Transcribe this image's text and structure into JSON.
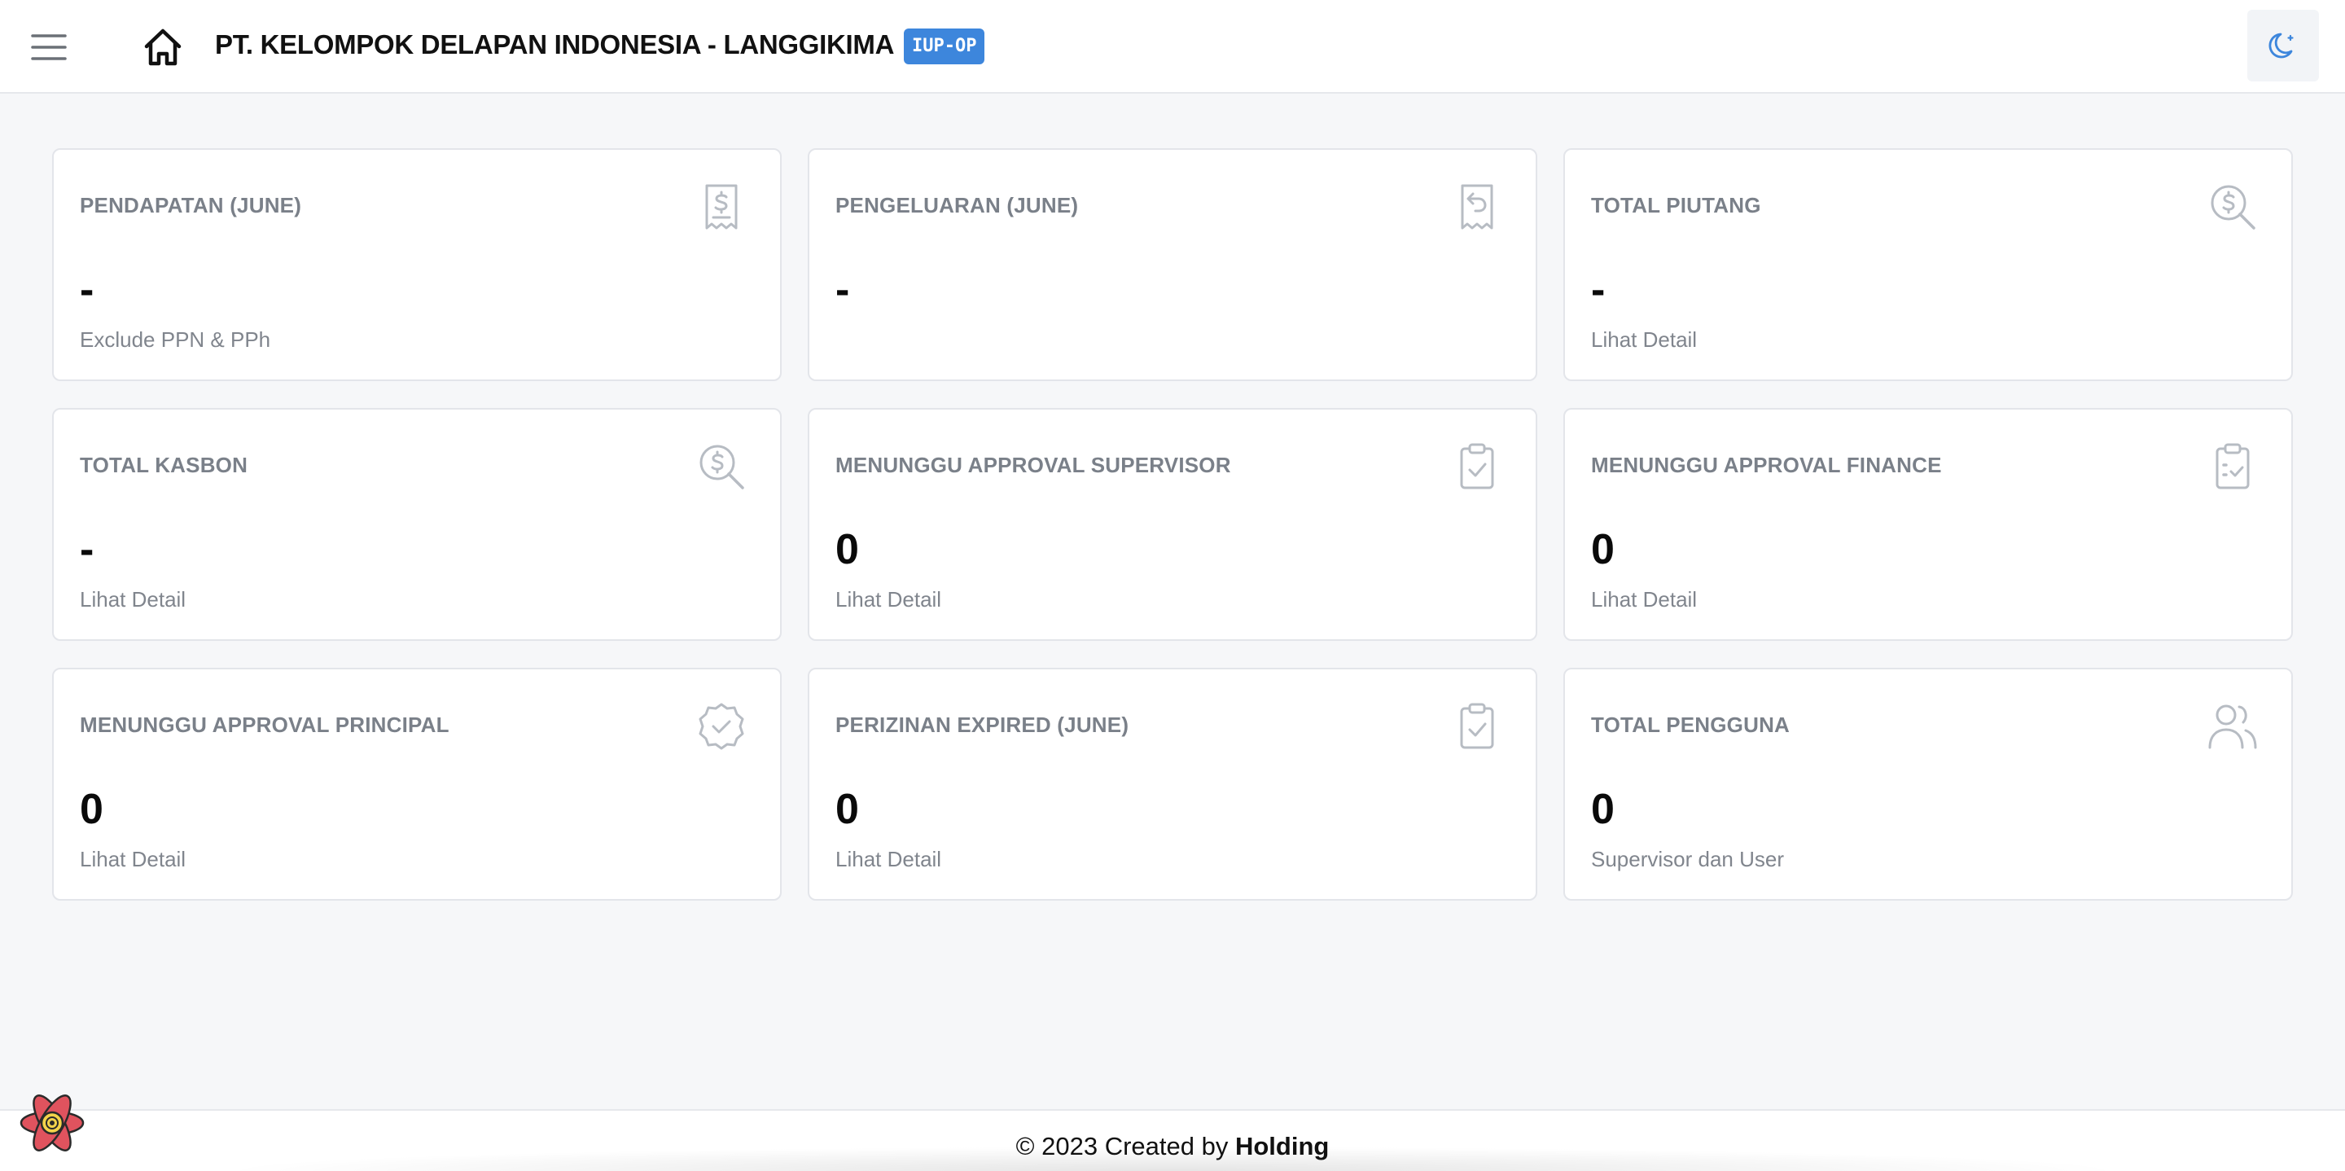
{
  "header": {
    "company_name": "PT. KELOMPOK DELAPAN INDONESIA - LANGGIKIMA",
    "badge": "IUP-OP",
    "menu_icon": "hamburger-menu-icon",
    "home_icon": "home-icon",
    "theme_icon": "moon-icon"
  },
  "colors": {
    "accent": "#3d86dc",
    "background": "#f6f7f9",
    "card_border": "#e3e5ea",
    "icon_muted": "#b7bcc3"
  },
  "cards": [
    {
      "title": "PENDAPATAN (JUNE)",
      "value": "-",
      "subtitle": "Exclude PPN & PPh",
      "icon": "receipt-dollar-icon"
    },
    {
      "title": "PENGELUARAN (JUNE)",
      "value": "-",
      "subtitle": "",
      "icon": "receipt-refund-icon"
    },
    {
      "title": "TOTAL PIUTANG",
      "value": "-",
      "subtitle": "Lihat Detail",
      "icon": "search-dollar-icon"
    },
    {
      "title": "TOTAL KASBON",
      "value": "-",
      "subtitle": "Lihat Detail",
      "icon": "search-dollar-icon"
    },
    {
      "title": "MENUNGGU APPROVAL SUPERVISOR",
      "value": "0",
      "subtitle": "Lihat Detail",
      "icon": "clipboard-check-icon"
    },
    {
      "title": "MENUNGGU APPROVAL FINANCE",
      "value": "0",
      "subtitle": "Lihat Detail",
      "icon": "clipboard-list-check-icon"
    },
    {
      "title": "MENUNGGU APPROVAL PRINCIPAL",
      "value": "0",
      "subtitle": "Lihat Detail",
      "icon": "badge-check-icon"
    },
    {
      "title": "PERIZINAN EXPIRED (JUNE)",
      "value": "0",
      "subtitle": "Lihat Detail",
      "icon": "clipboard-check-icon"
    },
    {
      "title": "TOTAL PENGGUNA",
      "value": "0",
      "subtitle": "Supervisor dan User",
      "icon": "users-icon"
    }
  ],
  "footer": {
    "prefix": "© 2023 Created by",
    "brand": "Holding"
  }
}
